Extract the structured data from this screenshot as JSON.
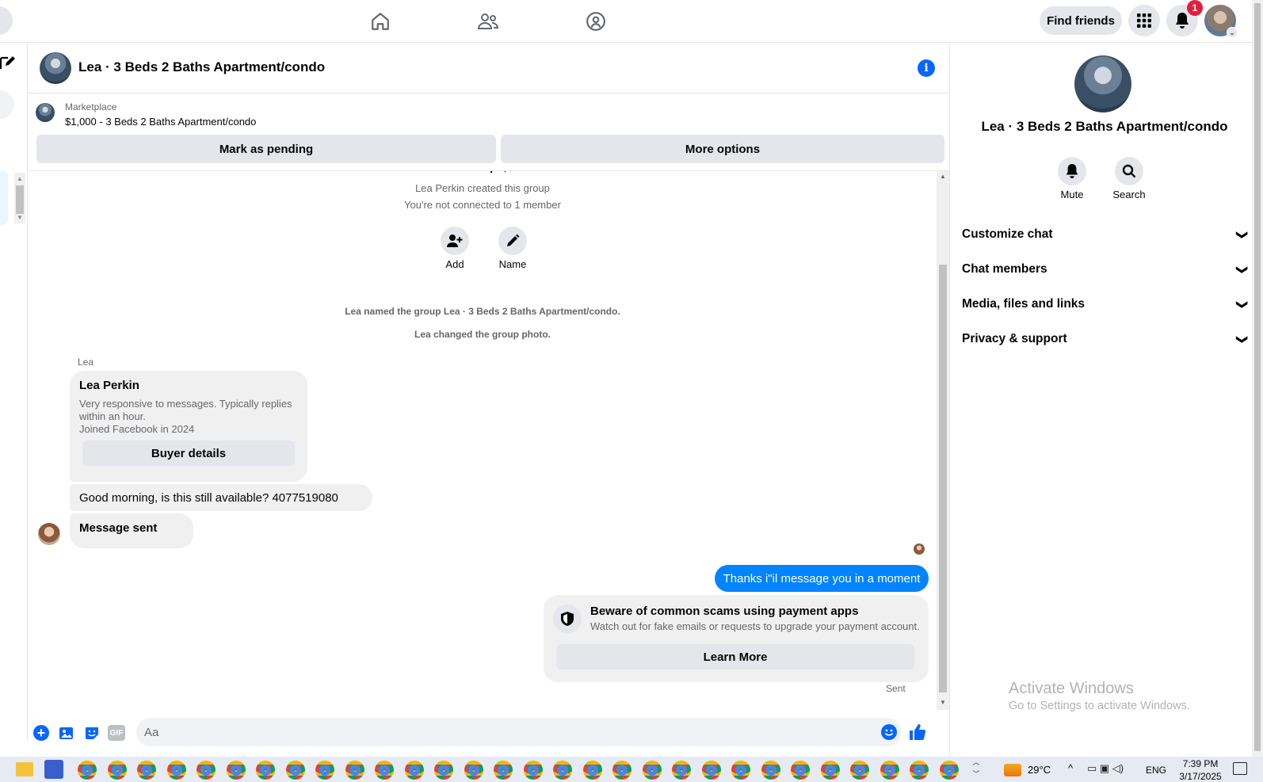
{
  "topnav": {
    "find_friends": "Find friends",
    "notif_count": "1"
  },
  "chat": {
    "title": "Lea · 3 Beds 2 Baths Apartment/condo",
    "marketplace_label": "Marketplace",
    "listing": "$1,000 - 3 Beds 2 Baths Apartment/condo",
    "mark_pending": "Mark as pending",
    "more_options": "More options",
    "created_group": "Lea Perkin created this group",
    "not_connected": "You're not connected to 1 member",
    "add_label": "Add",
    "name_label": "Name",
    "named_group": "Lea named the group Lea · 3 Beds 2 Baths Apartment/condo.",
    "changed_photo": "Lea changed the group photo.",
    "sender_small": "Lea",
    "card_name": "Lea Perkin",
    "card_desc1": "Very responsive to messages. Typically replies",
    "card_desc2": "within an hour.",
    "card_joined": "Joined Facebook in 2024",
    "buyer_details": "Buyer details",
    "msg1": "Good morning, is this still available? 4077519080",
    "msg2": "Message sent",
    "my_msg": "Thanks i\"il message you in a moment",
    "scam_title": "Beware of common scams using payment apps",
    "scam_desc": "Watch out for fake emails or requests to upgrade your payment account.",
    "learn_more": "Learn More",
    "sent_label": "Sent",
    "composer_placeholder": "Aa",
    "gif_label": "GIF"
  },
  "right_panel": {
    "title": "Lea · 3 Beds 2 Baths Apartment/condo",
    "mute": "Mute",
    "search": "Search",
    "sections": [
      "Customize chat",
      "Chat members",
      "Media, files and links",
      "Privacy & support"
    ]
  },
  "watermark": {
    "line1": "Activate Windows",
    "line2": "Go to Settings to activate Windows."
  },
  "taskbar": {
    "weather": "29°C",
    "lang": "ENG",
    "time": "7:39 PM",
    "date": "3/17/2025"
  },
  "colors": {
    "accent": "#0866ff",
    "bubble_blue": "#0084ff",
    "notif_red": "#e41e3f"
  }
}
